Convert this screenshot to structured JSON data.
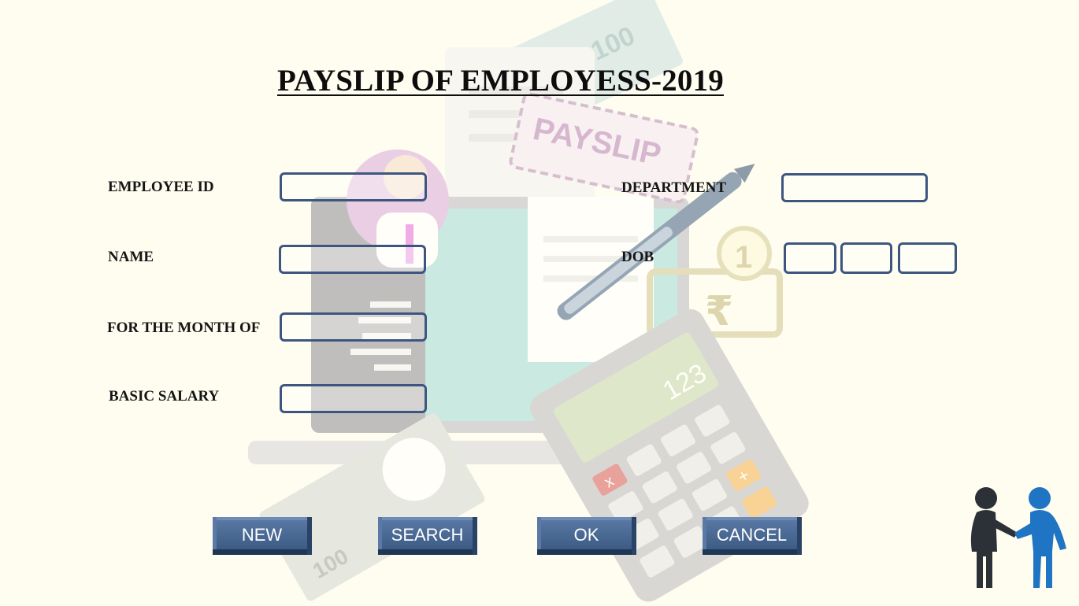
{
  "title": "PAYSLIP OF EMPLOYESS-2019",
  "form": {
    "employee_id": {
      "label": "EMPLOYEE ID",
      "value": ""
    },
    "name": {
      "label": "NAME",
      "value": ""
    },
    "month": {
      "label": "FOR THE MONTH OF",
      "value": ""
    },
    "basic_salary": {
      "label": "BASIC SALARY",
      "value": ""
    },
    "department": {
      "label": "DEPARTMENT",
      "value": ""
    },
    "dob": {
      "label": "DOB",
      "day": "",
      "month": "",
      "year": ""
    }
  },
  "buttons": {
    "new": "NEW",
    "search": "SEARCH",
    "ok": "OK",
    "cancel": "CANCEL"
  },
  "background": {
    "badge_text": "PAYSLIP",
    "note_value": "100",
    "coin_value": "1",
    "currency_symbol": "₹",
    "calculator_display": "123",
    "calc_x_key": "x",
    "calc_plus_key": "+"
  },
  "colors": {
    "page_background": "#fefdf0",
    "field_border": "#3d5680",
    "button_face": "#4a6a95"
  },
  "icons": {
    "background_art": "payslip-illustration",
    "corner": "handshake-icon"
  }
}
